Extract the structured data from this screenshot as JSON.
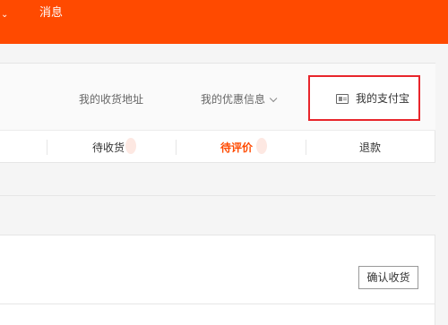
{
  "header": {
    "chevron_glyph": "⌄",
    "messages_label": "消息"
  },
  "toolbar": {
    "address_link": "我的收货地址",
    "coupon_link": "我的优惠信息",
    "alipay_link": "我的支付宝"
  },
  "status_tabs": {
    "to_receive": "待收货",
    "to_review": "待评价",
    "refund": "退款"
  },
  "order_list": {
    "confirm_receipt_button": "确认收货"
  },
  "colors": {
    "brand": "#ff4a00",
    "highlight_box": "#e8252b"
  },
  "icons": {
    "alipay": "id-card-icon",
    "coupon_dropdown": "chevron-down-icon"
  }
}
